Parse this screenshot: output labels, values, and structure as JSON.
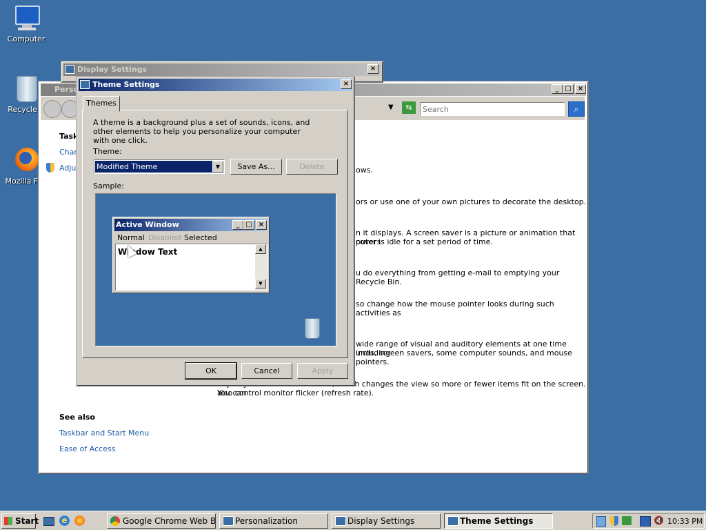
{
  "desktop": {
    "icons": [
      {
        "label": "Computer",
        "icon": "computer-icon"
      },
      {
        "label": "Recycle B",
        "icon": "recycle-bin-icon"
      },
      {
        "label": "Mozilla Fire",
        "icon": "firefox-icon"
      }
    ]
  },
  "personalization": {
    "title": "Perso",
    "search_placeholder": "Search",
    "tasks_heading": "Task",
    "tasks": [
      "Chan",
      "Adjus"
    ],
    "text_lines": [
      "ows.",
      "ors or use one of your own pictures to decorate the desktop.",
      "n it displays. A screen saver is a picture or animation that covers",
      "puter is idle for a set period of time.",
      "u do everything from getting e-mail to emptying your Recycle Bin.",
      "so change how the mouse pointer looks during such activities as",
      "wide range of visual and auditory elements at one time including",
      "unds, screen savers, some computer sounds, and mouse pointers.",
      "Adjust your monitor resolution, which changes the view so more or fewer items fit on the screen. You can",
      "also control monitor flicker (refresh rate)."
    ],
    "see_also_heading": "See also",
    "see_also": [
      "Taskbar and Start Menu",
      "Ease of Access"
    ]
  },
  "display_settings": {
    "title": "Display Settings"
  },
  "theme_settings": {
    "title": "Theme Settings",
    "tab": "Themes",
    "description": "A theme is a background plus a set of sounds, icons, and other elements to help you personalize your computer with one click.",
    "theme_label": "Theme:",
    "theme_value": "Modified Theme",
    "save_as": "Save As...",
    "delete": "Delete",
    "sample_label": "Sample:",
    "preview": {
      "title": "Active Window",
      "menu": [
        "Normal",
        "Disabled",
        "Selected"
      ],
      "window_text": "Window Text"
    },
    "ok": "OK",
    "cancel": "Cancel",
    "apply": "Apply"
  },
  "taskbar": {
    "start": "Start",
    "items": [
      {
        "label": "Google Chrome Web Bro...",
        "icon": "chrome-icon"
      },
      {
        "label": "Personalization",
        "icon": "personalization-icon"
      },
      {
        "label": "Display Settings",
        "icon": "display-icon"
      },
      {
        "label": "Theme Settings",
        "icon": "theme-icon"
      }
    ],
    "clock": "10:33 PM"
  },
  "colors": {
    "desktop": "#3a6ea5",
    "active_title": "#0a246a",
    "selection": "#0a246a"
  }
}
